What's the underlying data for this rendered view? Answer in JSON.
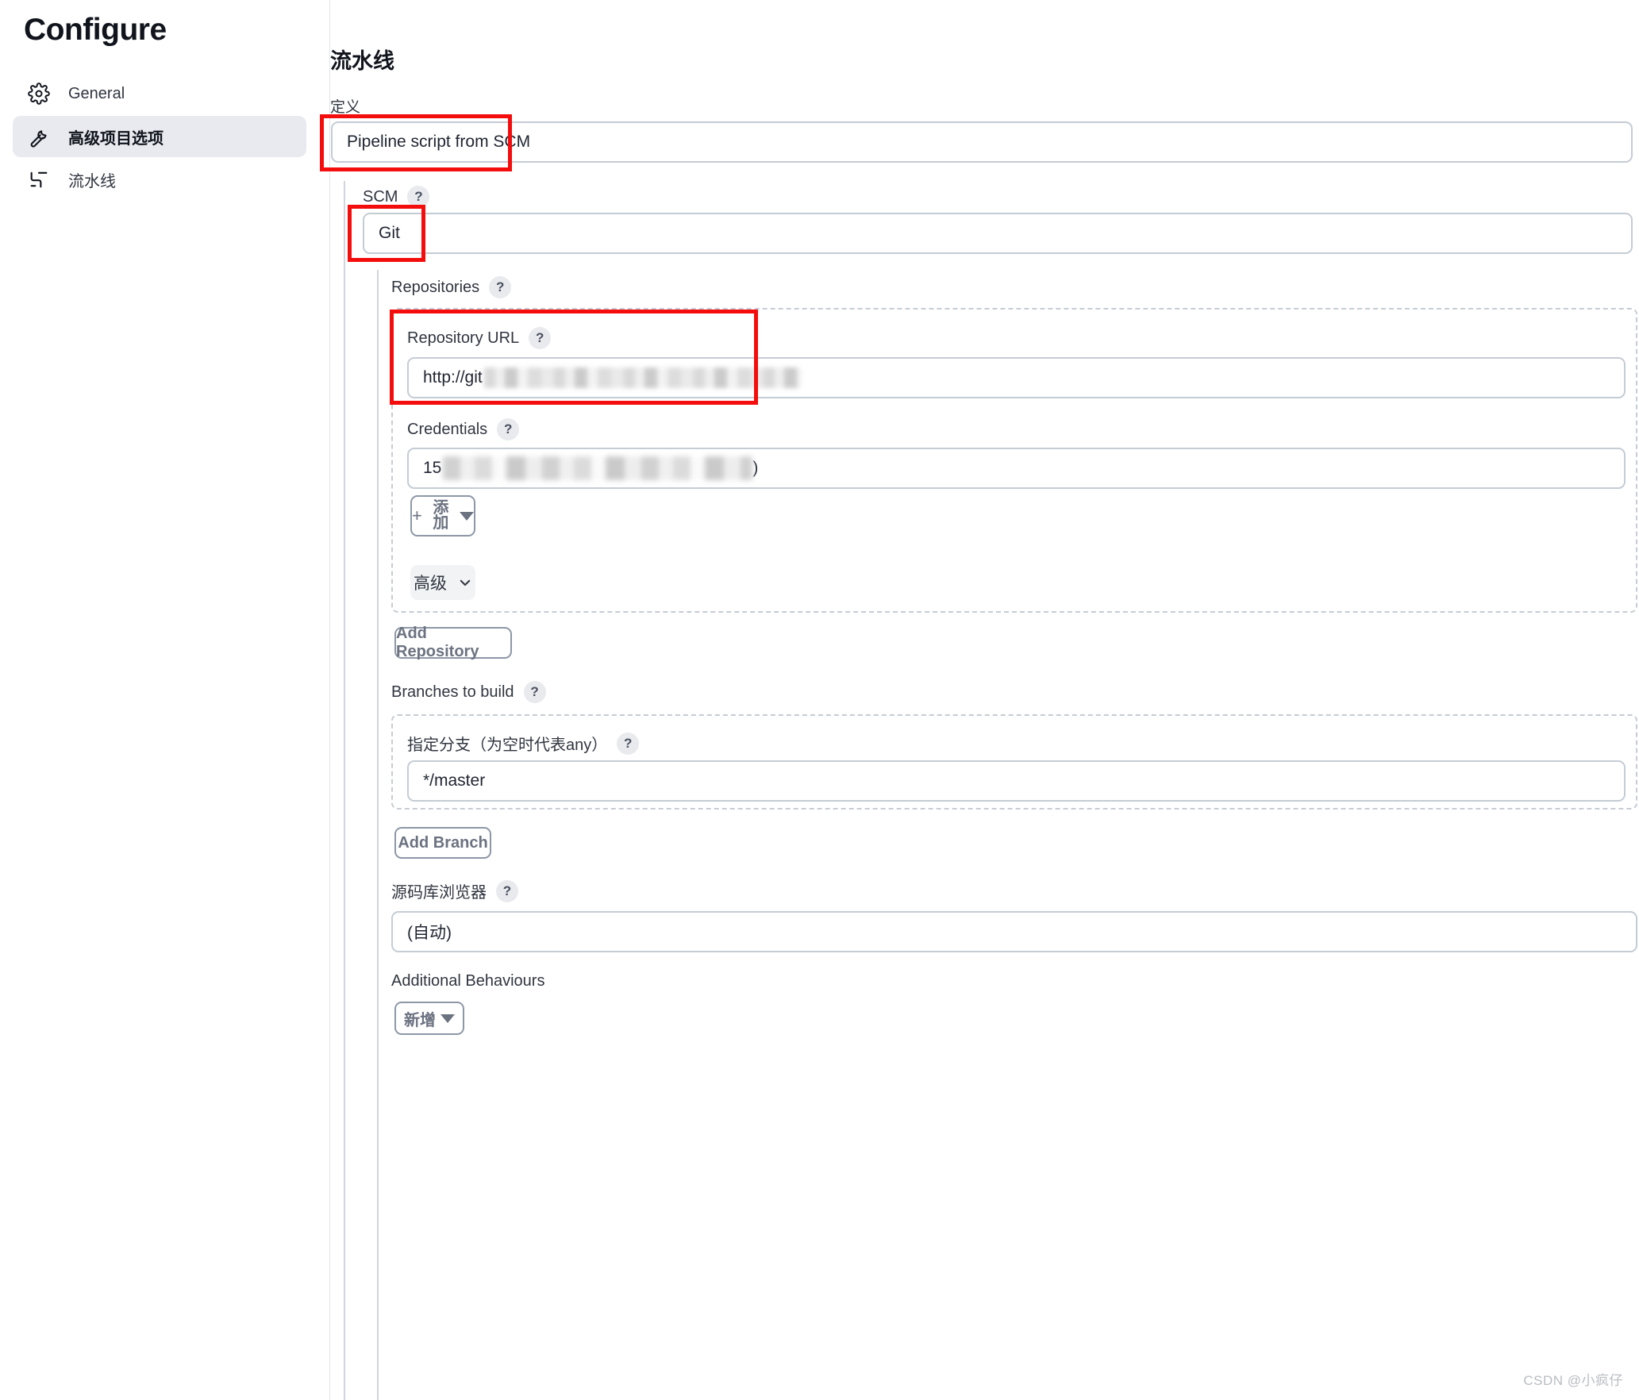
{
  "sidebar": {
    "title": "Configure",
    "items": [
      {
        "label": "General",
        "icon": "gear-icon",
        "active": false
      },
      {
        "label": "高级项目选项",
        "icon": "wrench-icon",
        "active": true
      },
      {
        "label": "流水线",
        "icon": "pipeline-icon",
        "active": false
      }
    ]
  },
  "main": {
    "section_title": "流水线",
    "definition": {
      "label": "定义",
      "value": "Pipeline script from SCM"
    },
    "scm": {
      "label": "SCM",
      "help": "?",
      "value": "Git"
    },
    "repositories": {
      "label": "Repositories",
      "help": "?",
      "repository_url": {
        "label": "Repository URL",
        "help": "?",
        "value_prefix": "http://git",
        "value_redacted": true
      },
      "credentials": {
        "label": "Credentials",
        "help": "?",
        "value_prefix": "15",
        "value_suffix": ")",
        "value_redacted": true
      },
      "add_credential_button": "添加",
      "advanced_button": "高级"
    },
    "add_repository_button": "Add Repository",
    "branches": {
      "label": "Branches to build",
      "help": "?",
      "specifier": {
        "label": "指定分支（为空时代表any）",
        "help": "?",
        "value": "*/master"
      }
    },
    "add_branch_button": "Add Branch",
    "repository_browser": {
      "label": "源码库浏览器",
      "help": "?",
      "value": "(自动)"
    },
    "additional_behaviours": {
      "label": "Additional Behaviours",
      "add_button": "新增"
    }
  },
  "watermark": "CSDN @小疯仔",
  "colors": {
    "annotation": "#f40d0d",
    "active_nav_bg": "#e8eaef",
    "input_border": "#c4ccd4"
  }
}
